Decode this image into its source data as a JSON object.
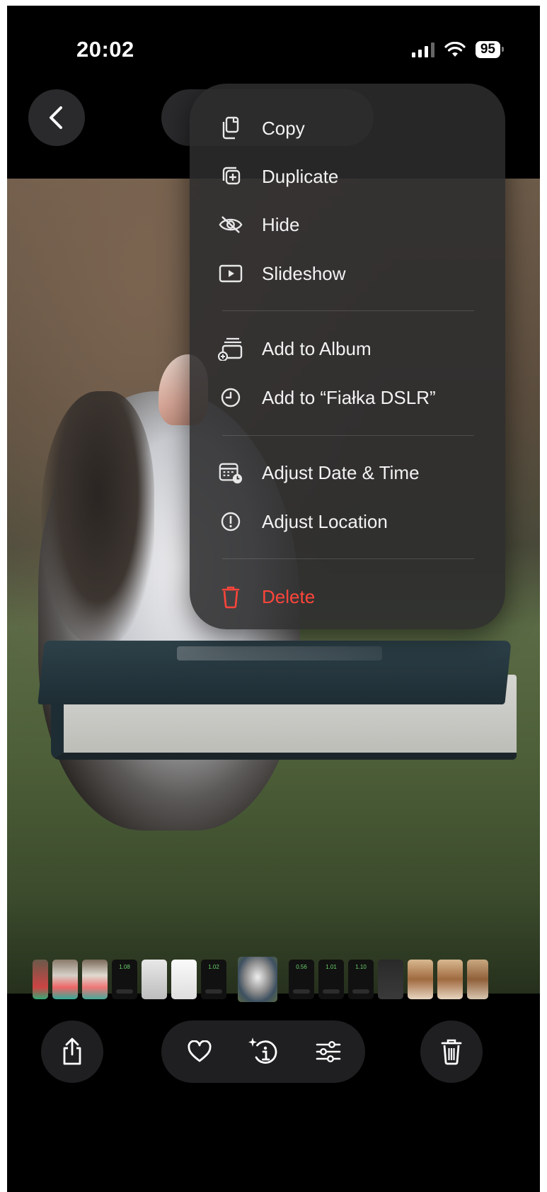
{
  "status_bar": {
    "time": "20:02",
    "battery": "95"
  },
  "menu": {
    "items": [
      {
        "label": "Copy",
        "icon": "copy-icon"
      },
      {
        "label": "Duplicate",
        "icon": "duplicate-icon"
      },
      {
        "label": "Hide",
        "icon": "eye-slash-icon"
      },
      {
        "label": "Slideshow",
        "icon": "play-rectangle-icon"
      },
      {
        "label": "Add to Album",
        "icon": "add-to-album-icon"
      },
      {
        "label": "Add to “Fiałka DSLR”",
        "icon": "clock-icon"
      },
      {
        "label": "Adjust Date & Time",
        "icon": "calendar-clock-icon"
      },
      {
        "label": "Adjust Location",
        "icon": "location-info-icon"
      },
      {
        "label": "Delete",
        "icon": "trash-icon"
      }
    ]
  },
  "thumbnails": {
    "labels": [
      "1.08",
      "1.02",
      "0.56",
      "1.01",
      "1.10"
    ]
  },
  "toolbar": {
    "share": "share-icon",
    "favorite": "heart-icon",
    "info": "sparkle-info-icon",
    "edit": "sliders-icon",
    "delete": "trash-icon"
  },
  "colors": {
    "danger": "#ff453a",
    "menu_bg": "#2c2c2e"
  }
}
